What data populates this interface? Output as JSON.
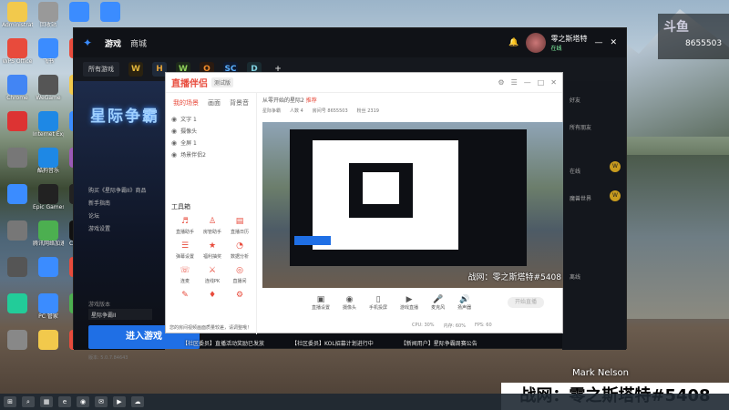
{
  "desktop": {
    "icons": [
      {
        "label": "Administrator",
        "color": "#f2c94c"
      },
      {
        "label": "WPS Office",
        "color": "#e84b3c"
      },
      {
        "label": "Chrome",
        "color": "#4285f4"
      },
      {
        "label": "",
        "color": "#d33"
      },
      {
        "label": "",
        "color": "#777"
      },
      {
        "label": "",
        "color": "#3b8cff"
      },
      {
        "label": "",
        "color": "#777"
      },
      {
        "label": "",
        "color": "#555"
      },
      {
        "label": "",
        "color": "#2c9"
      },
      {
        "label": "",
        "color": "#888"
      },
      {
        "label": "回收站",
        "color": "#999"
      },
      {
        "label": "飞书",
        "color": "#3b8cff"
      },
      {
        "label": "WeGame",
        "color": "#555"
      },
      {
        "label": "Internet Explorer",
        "color": "#1e88e5"
      },
      {
        "label": "酷狗音乐",
        "color": "#1e88e5"
      },
      {
        "label": "Epic Games",
        "color": "#222"
      },
      {
        "label": "腾讯网络加速器",
        "color": "#4caf50"
      },
      {
        "label": "",
        "color": "#3b8cff"
      },
      {
        "label": "PC 管家",
        "color": "#3b8cff"
      },
      {
        "label": "",
        "color": "#f2c94c"
      },
      {
        "label": "",
        "color": "#3b8cff"
      },
      {
        "label": "",
        "color": "#e84b3c"
      },
      {
        "label": "",
        "color": "#f2c94c"
      },
      {
        "label": "",
        "color": "#3b8cff"
      },
      {
        "label": "",
        "color": "#9b59b6"
      },
      {
        "label": "QQ",
        "color": "#222"
      },
      {
        "label": "CapCut",
        "color": "#111"
      },
      {
        "label": "",
        "color": "#e84b3c"
      },
      {
        "label": "",
        "color": "#4caf50"
      },
      {
        "label": "",
        "color": "#e84b3c"
      },
      {
        "label": "",
        "color": "#3b8cff"
      }
    ]
  },
  "launcher": {
    "logo": "battle-net-logo",
    "tabs": [
      "游戏",
      "商城"
    ],
    "user": {
      "name": "零之斯塔特",
      "status": "在线"
    },
    "game_bar": {
      "all_games": "所有游戏",
      "games": [
        "W",
        "H",
        "W",
        "O",
        "SC",
        "D"
      ],
      "add": "+"
    },
    "side": {
      "game_title": "星际争霸",
      "links": [
        "购买《星际争霸II》商品",
        "新手指南",
        "论坛",
        "游戏设置"
      ],
      "version_label": "游戏版本",
      "version_value": "星际争霸II",
      "play_button": "进入游戏",
      "build": "版本: 5.0.7.84643"
    },
    "right_panel": [
      "好友",
      "所有朋友",
      "在线",
      "魔兽世界",
      "离线"
    ]
  },
  "assistant": {
    "logo": "直播伴侣",
    "badge": "测试版",
    "left_tabs": [
      "我的场景",
      "画面",
      "背景音"
    ],
    "scenes": [
      "文字 1",
      "摄像头",
      "全屏 1",
      "场景伴侣2"
    ],
    "tools_title": "工具箱",
    "tools": [
      {
        "label": "直播助手",
        "icon": "♬"
      },
      {
        "label": "房管助手",
        "icon": "♙"
      },
      {
        "label": "直播日历",
        "icon": "▤"
      },
      {
        "label": "弹幕设置",
        "icon": "☰"
      },
      {
        "label": "福利抽奖",
        "icon": "★"
      },
      {
        "label": "数据分析",
        "icon": "◔"
      },
      {
        "label": "连麦",
        "icon": "☏"
      },
      {
        "label": "连线PK",
        "icon": "⚔"
      },
      {
        "label": "直播间",
        "icon": "◎"
      },
      {
        "label": "",
        "icon": "✎"
      },
      {
        "label": "",
        "icon": "♦"
      },
      {
        "label": "",
        "icon": "⚙"
      }
    ],
    "notice": "您的房间视频画面质量较差，请调整哦！",
    "main_title": "从零开始的星际2",
    "main_tag": "推荐",
    "meta": [
      "星际争霸",
      "人数 4",
      "房间号 8655503",
      "粉丝 2319"
    ],
    "preview_caption": "战网：零之斯塔特#5408",
    "controls": [
      "直播设置",
      "摄像头",
      "手机投屏",
      "游戏直播",
      "麦克风",
      "扬声器"
    ],
    "go_live": "开始直播",
    "status": [
      "CPU: 30%",
      "内存: 60%",
      "FPS: 60"
    ]
  },
  "overlays": {
    "tips": [
      "【社区委员】直播活动奖励已发放",
      "【社区委员】KOL招募计划进行中",
      "【新闻用户】星际争霸周赛公告"
    ],
    "photo_credit": "Mark Nelson",
    "battlenet_id": "战网：零之斯塔特#5408",
    "cam_logo": "斗鱼",
    "cam_id": "8655503"
  },
  "taskbar": {
    "items": [
      "⊞",
      "⌕",
      "▦",
      "e",
      "◉",
      "✉",
      "▶",
      "☁"
    ]
  },
  "colors": {
    "accent_blue": "#1f6fe5",
    "assistant_red": "#e84b3c"
  }
}
